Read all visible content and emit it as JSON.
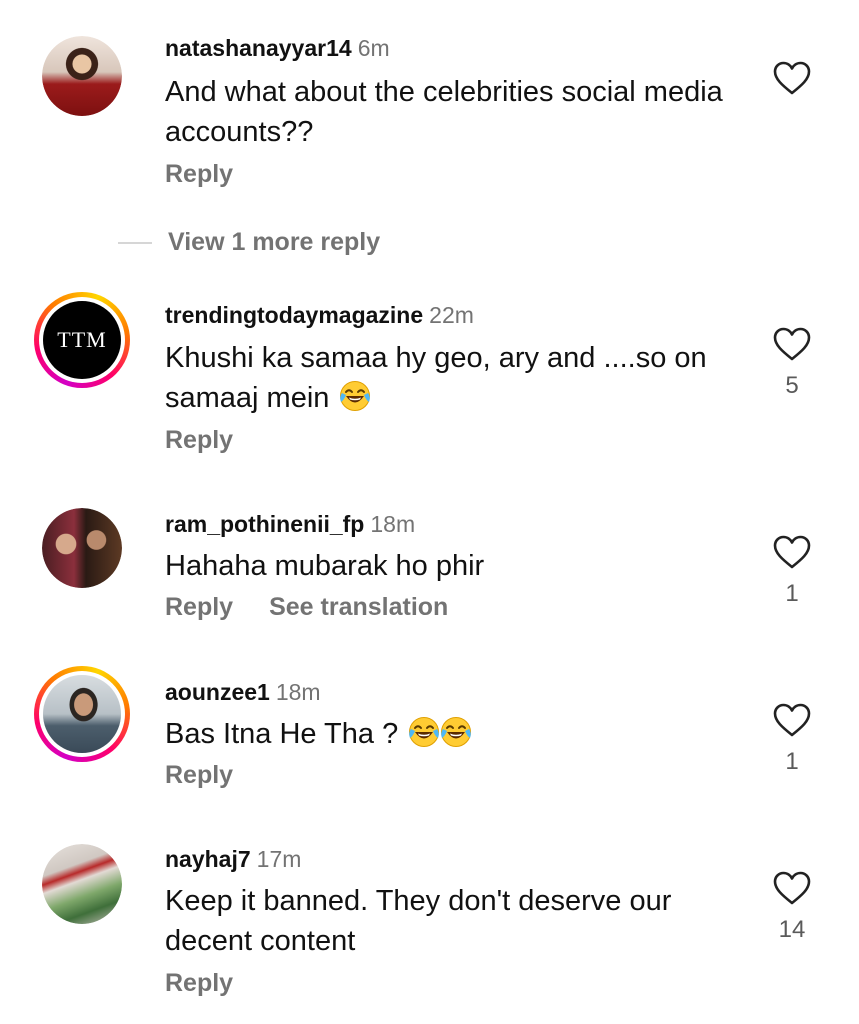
{
  "comments": [
    {
      "username": "natashanayyar14",
      "time": "6m",
      "text": "And what about the celebrities social media accounts??",
      "reply_label": "Reply",
      "likes": ""
    },
    {
      "username": "trendingtodaymagazine",
      "time": "22m",
      "text": "Khushi ka samaa hy geo, ary and ....so on samaaj mein",
      "emojis": [
        "laughing-tears"
      ],
      "reply_label": "Reply",
      "likes": "5",
      "avatar_text": "TTM"
    },
    {
      "username": "ram_pothinenii_fp",
      "time": "18m",
      "text": "Hahaha mubarak ho phir",
      "reply_label": "Reply",
      "translate_label": "See translation",
      "likes": "1"
    },
    {
      "username": "aounzee1",
      "time": "18m",
      "text": "Bas Itna He Tha ?",
      "emojis": [
        "laughing-tears",
        "laughing-tears"
      ],
      "reply_label": "Reply",
      "likes": "1"
    },
    {
      "username": "nayhaj7",
      "time": "17m",
      "text": "Keep it banned. They don't deserve our decent content",
      "reply_label": "Reply",
      "likes": "14"
    }
  ],
  "view_more_replies": "View 1 more reply",
  "icons": {
    "heart": "heart-outline-icon",
    "emoji": "face-with-tears-of-joy"
  },
  "colors": {
    "secondary_text": "#737373",
    "primary_text": "#111111",
    "story_ring": [
      "#d300c5",
      "#ff0069",
      "#ff7a00",
      "#ffd600"
    ]
  }
}
